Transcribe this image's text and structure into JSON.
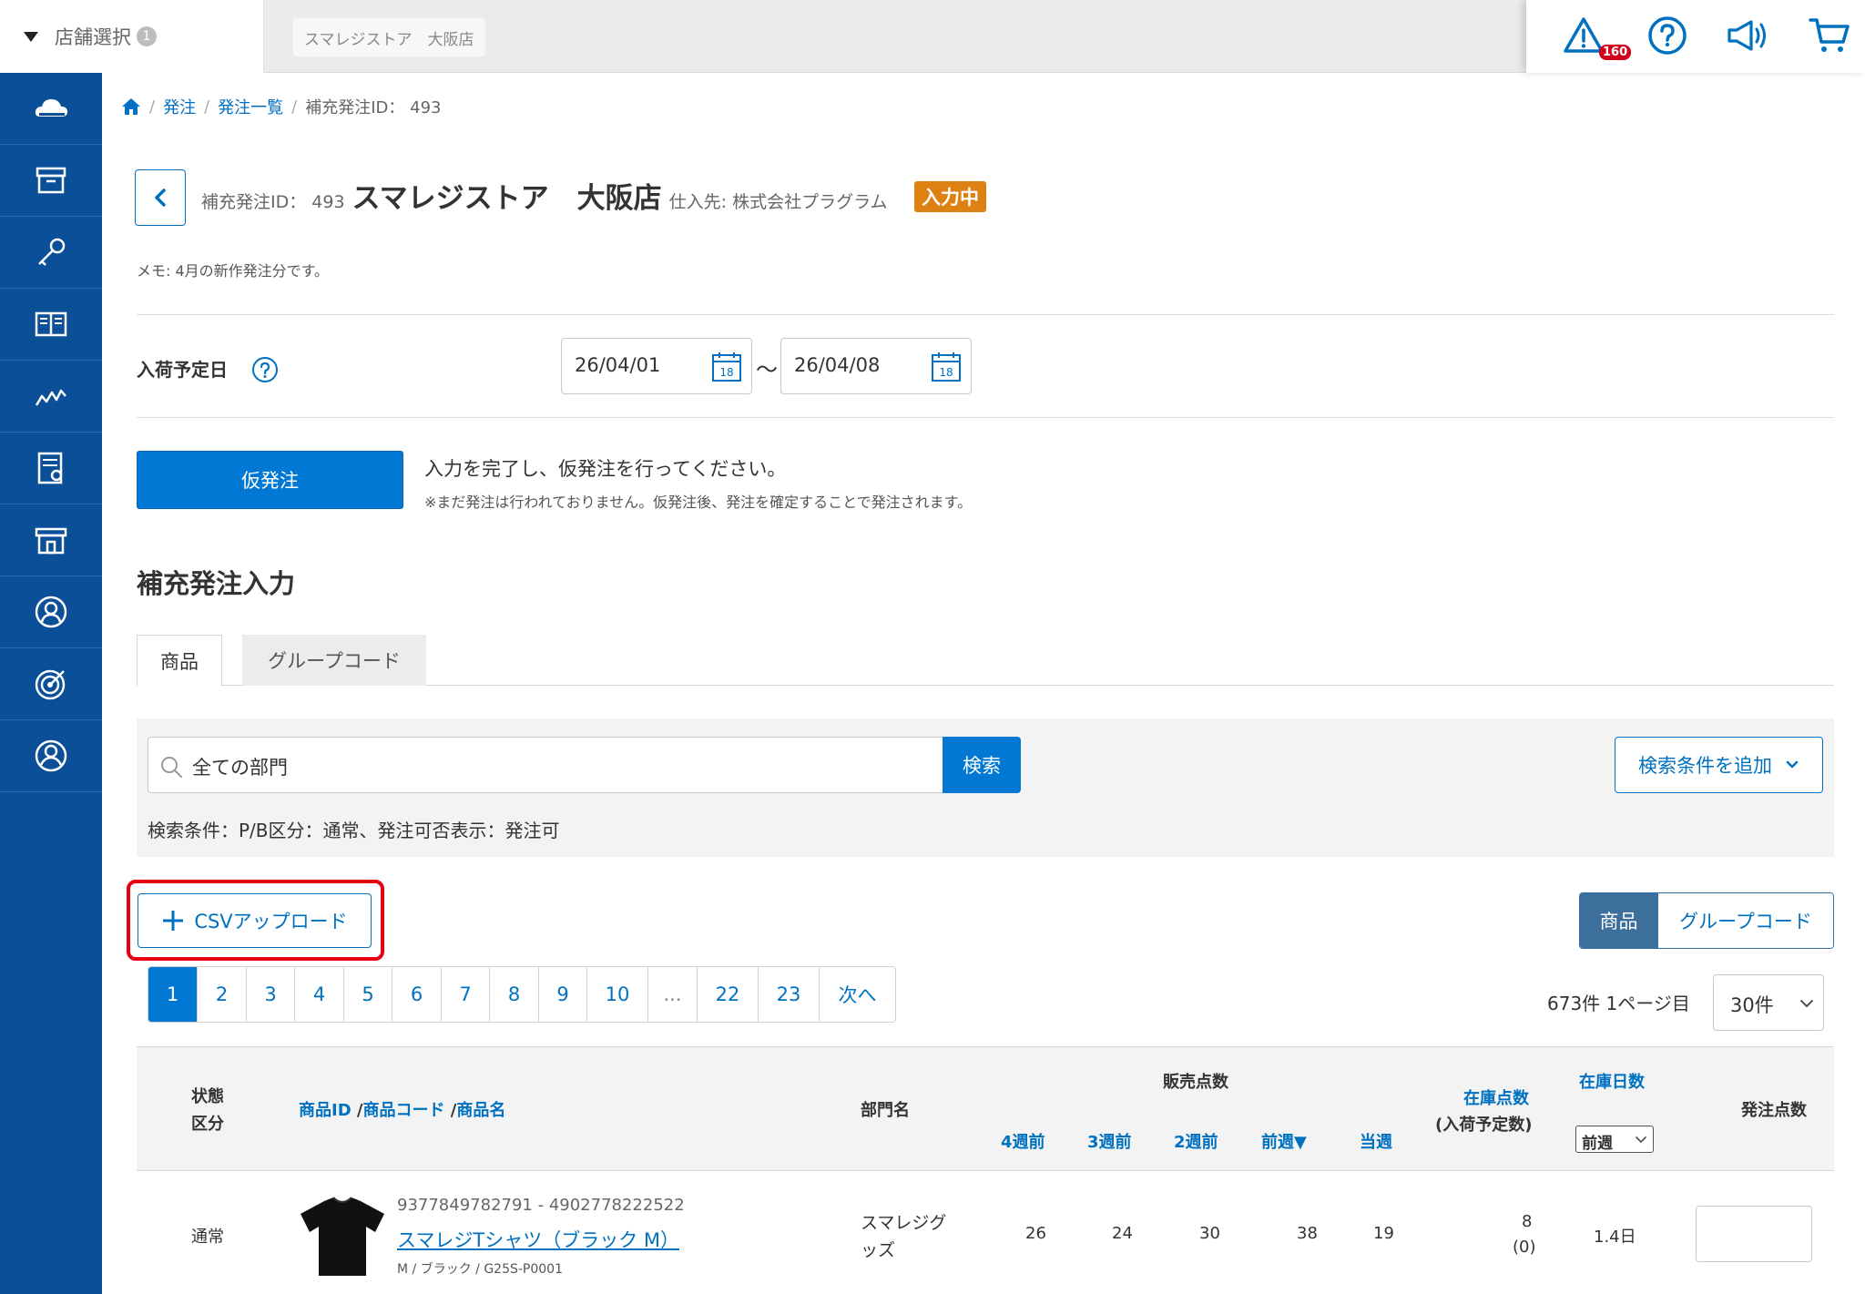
{
  "topbar": {
    "store_select_label": "店舗選択",
    "store_select_count": "1",
    "current_store": "スマレジストア　大阪店",
    "alert_count": "160"
  },
  "breadcrumb": [
    "発注",
    "発注一覧",
    "補充発注ID： 493"
  ],
  "header": {
    "id_label": "補充発注ID： 493",
    "store_name": "スマレジストア　大阪店",
    "supplier": "仕入先: 株式会社プラグラム",
    "status": "入力中",
    "memo": "メモ: 4月の新作発注分です。"
  },
  "arrival": {
    "label": "入荷予定日",
    "from": "26/04/01",
    "to": "26/04/08",
    "calendar_day": "18",
    "separator": "〜"
  },
  "provisional": {
    "button": "仮発注",
    "message": "入力を完了し、仮発注を行ってください。",
    "note": "※まだ発注は行われておりません。仮発注後、発注を確定することで発注されます。"
  },
  "section_title": "補充発注入力",
  "tabs": [
    "商品",
    "グループコード"
  ],
  "search": {
    "query": "全ての部門",
    "button": "検索",
    "add_condition": "検索条件を追加",
    "conditions": "検索条件：P/B区分：通常、発注可否表示：発注可"
  },
  "csv_button": "CSVアップロード",
  "view_toggle": [
    "商品",
    "グループコード"
  ],
  "pagination": {
    "pages": [
      "1",
      "2",
      "3",
      "4",
      "5",
      "6",
      "7",
      "8",
      "9",
      "10",
      "...",
      "22",
      "23",
      "次へ"
    ],
    "current": "1",
    "info": "673件 1ページ目",
    "per_page": "30件"
  },
  "table": {
    "headers": {
      "status_line1": "状態",
      "status_line2": "区分",
      "product_id": "商品ID",
      "product_code": "商品コード",
      "product_name": "商品名",
      "category": "部門名",
      "sales": "販売点数",
      "w4": "4週前",
      "w3": "3週前",
      "w2": "2週前",
      "w1": "前週▼",
      "cur": "当週",
      "stock": "在庫点数",
      "stock_sub": "(入荷予定数)",
      "stock_days": "在庫日数",
      "stock_days_period": "前週",
      "order_qty": "発注点数"
    },
    "rows": [
      {
        "status": "通常",
        "codes": "9377849782791 - 4902778222522",
        "name": "スマレジTシャツ（ブラック M）",
        "variant": "M / ブラック / G25S-P0001",
        "category_line1": "スマレジグ",
        "category_line2": "ッズ",
        "w4": "26",
        "w3": "24",
        "w2": "30",
        "w1": "38",
        "cur": "19",
        "stock": "8",
        "incoming": "(0)",
        "stock_days": "1.4日",
        "order_qty": ""
      }
    ]
  },
  "colors": {
    "sidebar": "#0a4f97",
    "primary": "#0078d4",
    "link": "#0071c1",
    "status_badge": "#dd8112",
    "highlight": "#e60012",
    "alert": "#d0021b"
  }
}
